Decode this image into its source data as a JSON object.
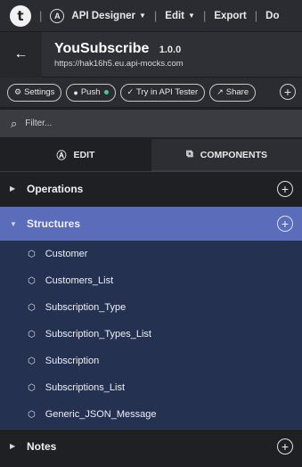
{
  "topbar": {
    "logo": "t",
    "items": [
      {
        "icon": "a-circle-icon",
        "label": "API Designer",
        "has_caret": true
      },
      {
        "label": "Edit",
        "has_caret": true
      },
      {
        "label": "Export"
      },
      {
        "label": "Do"
      }
    ]
  },
  "project": {
    "title": "YouSubscribe",
    "version": "1.0.0",
    "url": "https://hak16h5.eu.api-mocks.com"
  },
  "actions": {
    "settings": "Settings",
    "push": "Push",
    "try": "Try in API Tester",
    "share": "Share",
    "push_status_color": "#3ecf8e"
  },
  "filter": {
    "placeholder": "Filter..."
  },
  "tabs": {
    "edit": "EDIT",
    "components": "COMPONENTS"
  },
  "sections": {
    "operations": "Operations",
    "structures": "Structures",
    "notes": "Notes"
  },
  "structures": [
    "Customer",
    "Customers_List",
    "Subscription_Type",
    "Subscription_Types_List",
    "Subscription",
    "Subscriptions_List",
    "Generic_JSON_Message"
  ],
  "colors": {
    "accent": "#5a6cba",
    "structures_bg": "#253151",
    "background": "#1f2024"
  }
}
